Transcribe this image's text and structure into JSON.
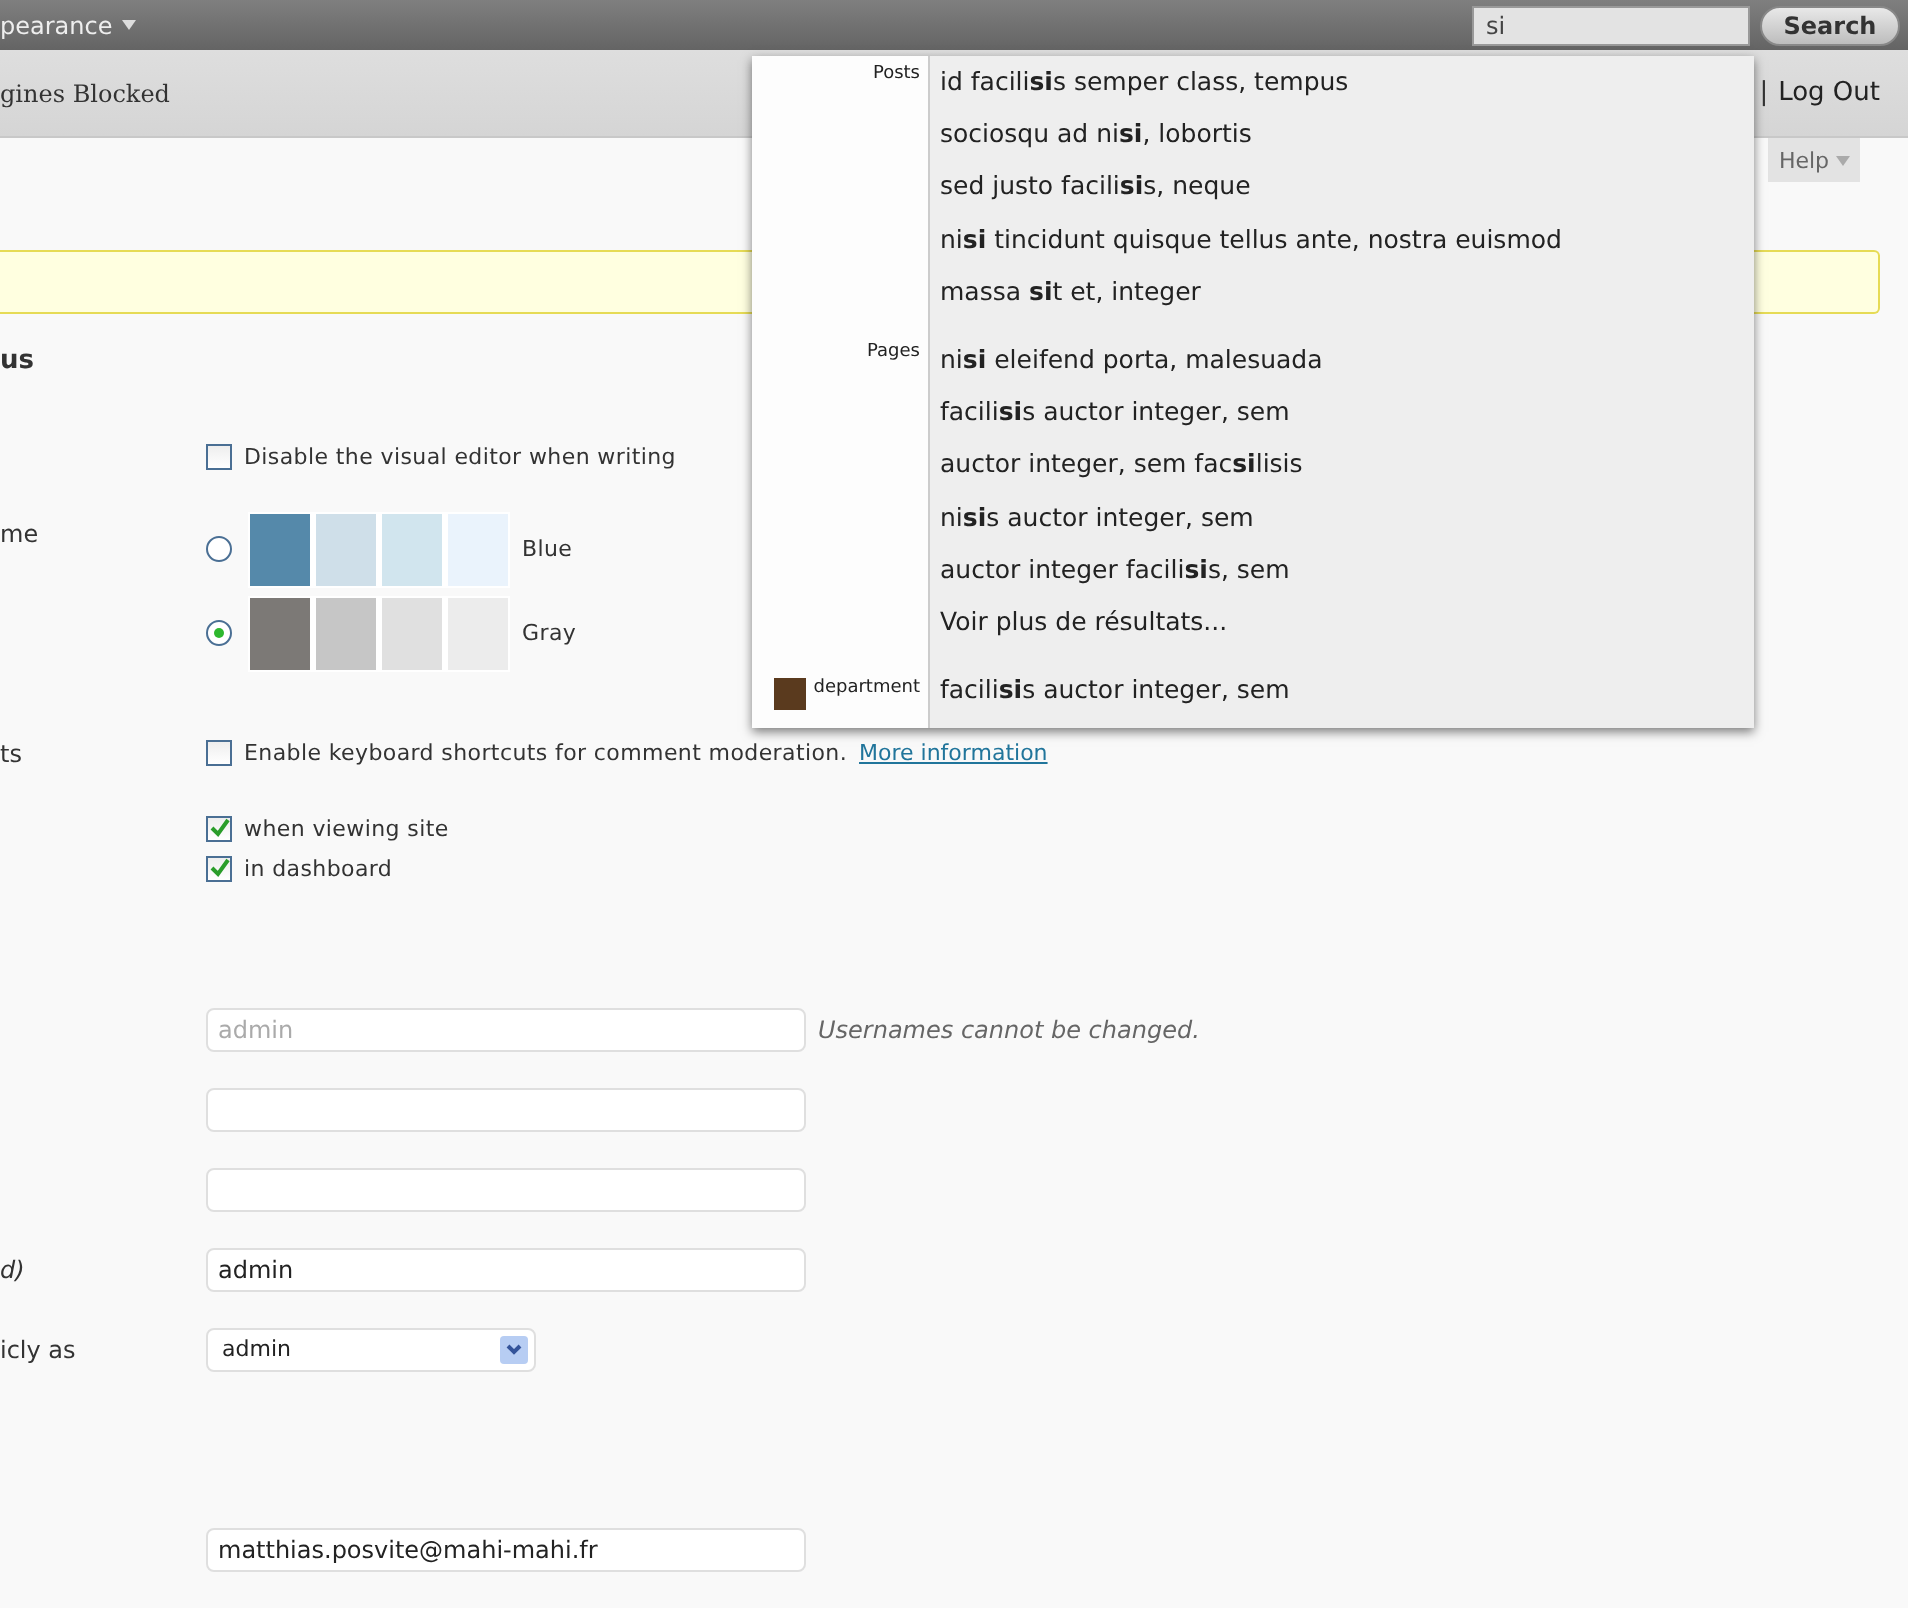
{
  "admin_bar": {
    "menu": "pearance",
    "search": {
      "value": "si",
      "button": "Search"
    }
  },
  "header": {
    "site": "gines Blocked",
    "separator": "|",
    "logout": "Log Out"
  },
  "help": "Help",
  "heading": "us",
  "search_results": [
    {
      "group": "Posts",
      "thumbnail": false,
      "items": [
        "id facili**si**s semper class, tempus",
        "sociosqu ad ni**si**, lobortis",
        "sed justo facili**si**s, neque",
        "ni**si** tincidunt quisque tellus ante, nostra euismod",
        "massa **si**t et, integer"
      ]
    },
    {
      "group": "Pages",
      "thumbnail": false,
      "items": [
        "ni**si** eleifend porta, malesuada",
        "facili**si**s auctor integer, sem",
        "auctor integer, sem fac**si**lisis",
        "ni**si**s auctor integer, sem",
        "auctor integer facili**si**s, sem",
        "Voir plus de résultats..."
      ]
    },
    {
      "group": "department",
      "thumbnail": true,
      "items": [
        "facili**si**s auctor integer, sem"
      ]
    }
  ],
  "form": [
    {
      "rows": [
        {
          "kind": "checkbox",
          "text": "Disable the visual editor when writing",
          "checked": false
        },
        {
          "kind": "scheme",
          "label": "me",
          "options": [
            {
              "name": "Blue",
              "selected": false,
              "swatches": [
                {
                  "color": "#5589aa"
                },
                {
                  "color": "#cfdfe9"
                },
                {
                  "color": "#d1e5ee"
                },
                {
                  "color": "#eaf3fc"
                }
              ]
            },
            {
              "name": "Gray",
              "selected": true,
              "swatches": [
                {
                  "color": "#7c7976"
                },
                {
                  "color": "#c6c6c6"
                },
                {
                  "color": "#e0e0e0"
                },
                {
                  "color": "#ececec"
                }
              ]
            }
          ]
        },
        {
          "kind": "checkbox",
          "label": "ts",
          "text": "Enable keyboard shortcuts for comment moderation.",
          "link": "More information",
          "checked": false
        },
        {
          "kind": "subcheckbox",
          "text": "when viewing site",
          "checked": true
        },
        {
          "kind": "subcheckbox",
          "text": "in dashboard",
          "checked": true
        }
      ]
    },
    {
      "rows": [
        {
          "kind": "input",
          "value": "admin",
          "disabled": true,
          "note": "Usernames cannot be changed."
        },
        {
          "kind": "input"
        },
        {
          "kind": "input"
        },
        {
          "kind": "input",
          "label": "d)",
          "value": "admin"
        },
        {
          "kind": "select",
          "label": "icly as",
          "value": "admin"
        }
      ]
    },
    {
      "rows": [
        {
          "kind": "input",
          "value": "matthias.posvite@mahi-mahi.fr"
        }
      ]
    }
  ]
}
